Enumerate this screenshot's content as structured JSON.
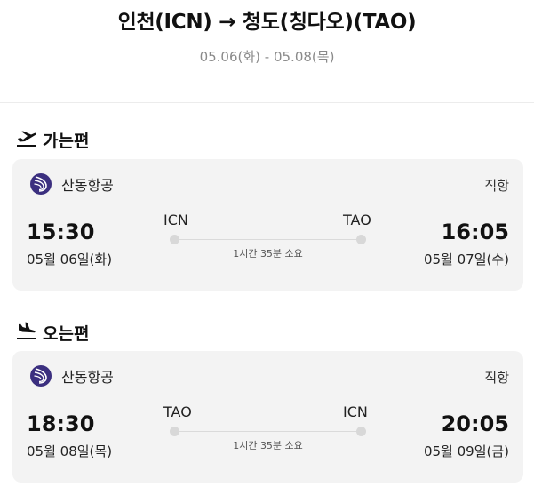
{
  "header": {
    "title": "인천(ICN) → 청도(칭다오)(TAO)",
    "dates": "05.06(화) - 05.08(목)"
  },
  "outbound": {
    "section_label": "가는편",
    "section_icon": "plane-takeoff-icon",
    "airline": "산동항공",
    "stops": "직항",
    "departure_code": "ICN",
    "arrival_code": "TAO",
    "departure_time": "15:30",
    "arrival_time": "16:05",
    "departure_date": "05월 06일(화)",
    "arrival_date": "05월 07일(수)",
    "duration": "1시간 35분 소요"
  },
  "inbound": {
    "section_label": "오는편",
    "section_icon": "plane-landing-icon",
    "airline": "산동항공",
    "stops": "직항",
    "departure_code": "TAO",
    "arrival_code": "ICN",
    "departure_time": "18:30",
    "arrival_time": "20:05",
    "departure_date": "05월 08일(목)",
    "arrival_date": "05월 09일(금)",
    "duration": "1시간 35분 소요"
  },
  "colors": {
    "card_background": "#f3f3f3",
    "airline_logo": "#3b2f7f",
    "muted_text": "#8a8a8a"
  }
}
